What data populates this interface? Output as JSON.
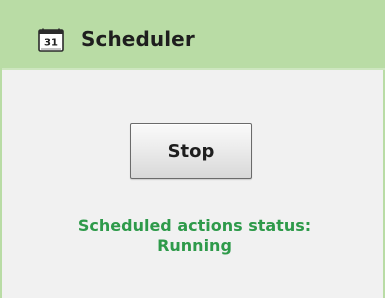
{
  "header": {
    "icon": "calendar-icon",
    "icon_day": "31",
    "title": "Scheduler"
  },
  "controls": {
    "stop_label": "Stop"
  },
  "status": {
    "label": "Scheduled actions status:",
    "value": "Running",
    "color": "#2e9a4a"
  },
  "colors": {
    "header_bg": "#b9dca5",
    "panel_bg": "#f1f1f1"
  }
}
